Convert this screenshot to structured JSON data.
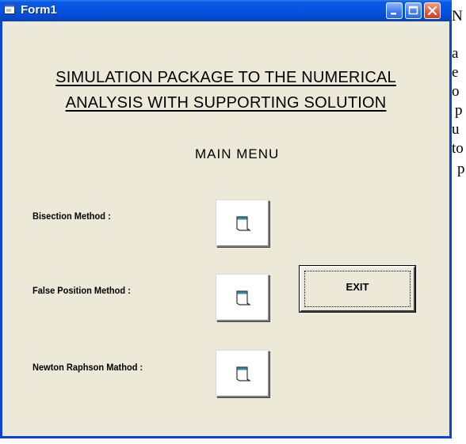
{
  "window": {
    "title": "Form1"
  },
  "background_text": [
    "N",
    "a",
    "e",
    "o",
    "p",
    "u",
    "to",
    "p"
  ],
  "form": {
    "heading_line1": "SIMULATION PACKAGE TO THE NUMERICAL",
    "heading_line2": "ANALYSIS WITH SUPPORTING SOLUTION",
    "menu_title": "MAIN MENU",
    "methods": [
      {
        "label": "Bisection Method :"
      },
      {
        "label": "False Position Method :"
      },
      {
        "label": "Newton Raphson Mathod :"
      }
    ],
    "exit_label": "EXIT"
  },
  "icons": {
    "window_icon": "form-icon",
    "method_button_icon": "window-icon",
    "minimize": "minimize-icon",
    "maximize": "maximize-icon",
    "close": "close-icon"
  }
}
